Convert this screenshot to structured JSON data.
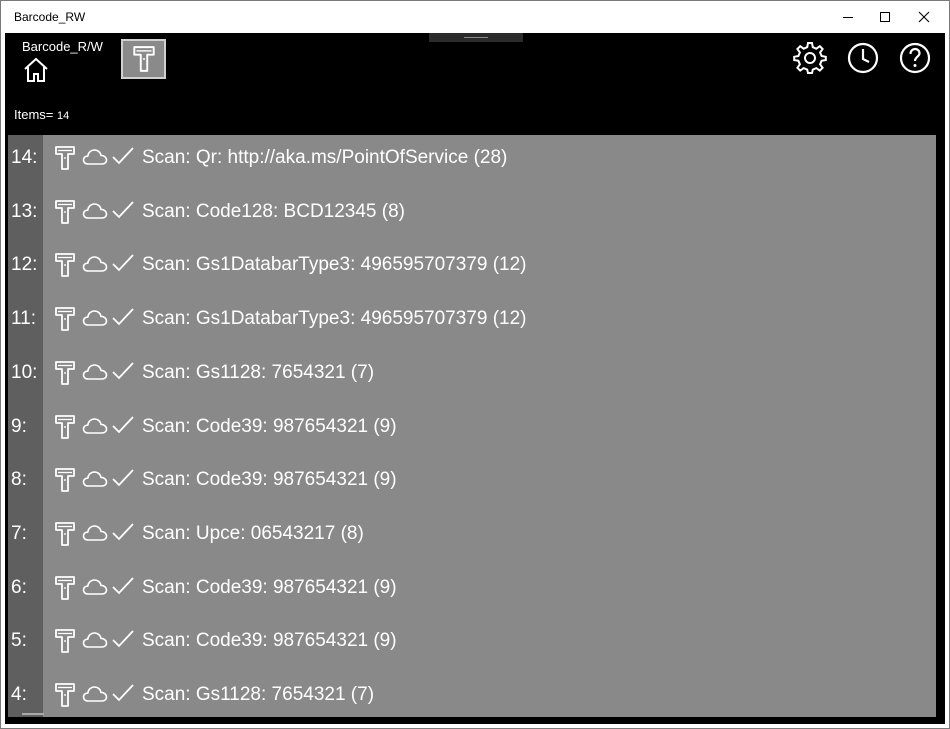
{
  "window": {
    "title": "Barcode_RW"
  },
  "app": {
    "title": "Barcode_R/W",
    "items_label": "Items=",
    "items_count": "14"
  },
  "colors": {
    "app_background": "#000000",
    "list_background": "#898989",
    "list_index_strip": "#5f5f5f",
    "text": "#ffffff"
  },
  "icons": {
    "home": "home-icon",
    "scanner": "barcode-scanner-icon",
    "settings": "gear-icon",
    "history": "clock-icon",
    "help": "help-icon",
    "row_icons": [
      "barcode-scanner-icon",
      "cloud-icon",
      "checkmark-icon"
    ]
  },
  "scans": [
    {
      "index": "14:",
      "text": "Scan: Qr: http://aka.ms/PointOfService (28)"
    },
    {
      "index": "13:",
      "text": "Scan: Code128: BCD12345 (8)"
    },
    {
      "index": "12:",
      "text": "Scan: Gs1DatabarType3: 496595707379 (12)"
    },
    {
      "index": "11:",
      "text": "Scan: Gs1DatabarType3: 496595707379 (12)"
    },
    {
      "index": "10:",
      "text": "Scan: Gs1128: 7654321 (7)"
    },
    {
      "index": "9:",
      "text": "Scan: Code39: 987654321 (9)"
    },
    {
      "index": "8:",
      "text": "Scan: Code39: 987654321 (9)"
    },
    {
      "index": "7:",
      "text": "Scan: Upce: 06543217 (8)"
    },
    {
      "index": "6:",
      "text": "Scan: Code39: 987654321 (9)"
    },
    {
      "index": "5:",
      "text": "Scan: Code39: 987654321 (9)"
    },
    {
      "index": "4:",
      "text": "Scan: Gs1128: 7654321 (7)"
    }
  ]
}
